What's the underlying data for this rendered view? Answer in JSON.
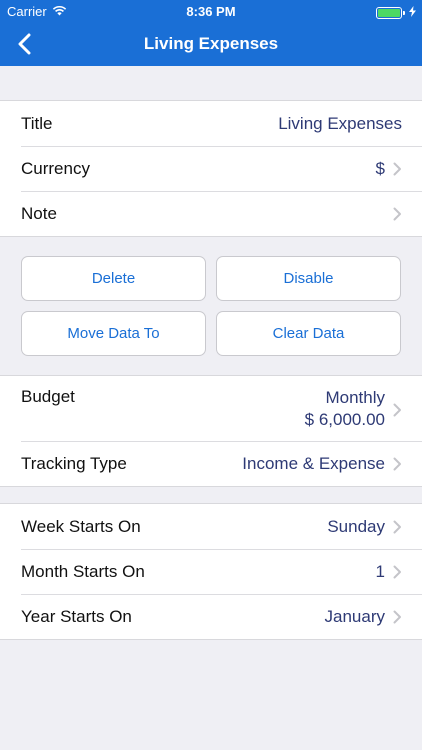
{
  "status_bar": {
    "carrier": "Carrier",
    "time": "8:36 PM"
  },
  "nav": {
    "title": "Living Expenses",
    "back_icon": "chevron-left-icon"
  },
  "info_group": {
    "title_label": "Title",
    "title_value": "Living Expenses",
    "currency_label": "Currency",
    "currency_value": "$",
    "note_label": "Note"
  },
  "actions": {
    "delete_label": "Delete",
    "disable_label": "Disable",
    "move_label": "Move Data To",
    "clear_label": "Clear Data"
  },
  "budget_group": {
    "budget_label": "Budget",
    "budget_period": "Monthly",
    "budget_amount": "$ 6,000.00",
    "tracking_label": "Tracking Type",
    "tracking_value": "Income & Expense"
  },
  "period_group": {
    "week_label": "Week Starts On",
    "week_value": "Sunday",
    "month_label": "Month Starts On",
    "month_value": "1",
    "year_label": "Year Starts On",
    "year_value": "January"
  },
  "colors": {
    "accent": "#1a6fd6",
    "value_text": "#2e3a75",
    "background": "#efeff4",
    "battery": "#4cd964"
  }
}
